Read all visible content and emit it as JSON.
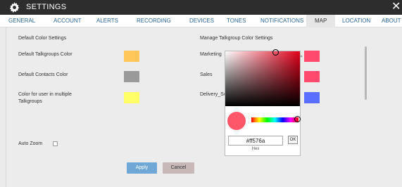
{
  "titlebar": {
    "title": "SETTINGS",
    "icon": "gear-icon",
    "close": "✕"
  },
  "tabs": [
    {
      "label": "GENERAL"
    },
    {
      "label": "ACCOUNT"
    },
    {
      "label": "ALERTS"
    },
    {
      "label": "RECORDING"
    },
    {
      "label": "DEVICES"
    },
    {
      "label": "TONES"
    },
    {
      "label": "NOTIFICATIONS"
    },
    {
      "label": "MAP",
      "active": true
    },
    {
      "label": "LOCATION"
    },
    {
      "label": "ABOUT"
    }
  ],
  "default_colors": {
    "heading": "Default Color Settings",
    "talkgroups_label": "Default Talkgroups Color",
    "talkgroups_color": "#ffc75a",
    "contacts_label": "Default Contacts Color",
    "contacts_color": "#9a9a9a",
    "multi_label_line1": "Color for user in multiple",
    "multi_label_line2": "Talkgroups",
    "multi_color": "#ffff66"
  },
  "manage": {
    "heading": "Manage Talkgroup Color Settings",
    "items": [
      {
        "label": "Marketing",
        "color": "#ff4a6e"
      },
      {
        "label": "Sales",
        "color": "#ff4a6e"
      },
      {
        "label": "Delivery_So",
        "color": "#5a6eff"
      }
    ]
  },
  "auto_zoom": {
    "label": "Auto Zoom",
    "checked": false
  },
  "buttons": {
    "apply": "Apply",
    "cancel": "Cancel"
  },
  "picker": {
    "hex_value": "#ff576a",
    "hex_label": "Hex",
    "ok": "OK",
    "preview_color": "#ff576a"
  }
}
